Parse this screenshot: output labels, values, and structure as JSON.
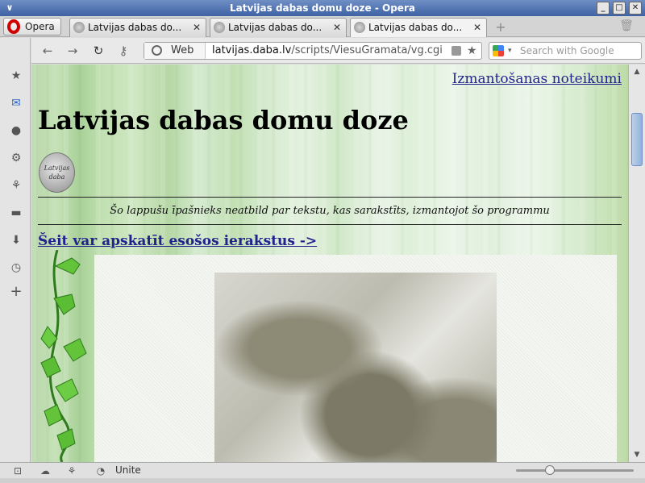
{
  "window": {
    "title": "Latvijas dabas domu doze - Opera",
    "menu_symbol": "∨",
    "btn_minimize": "_",
    "btn_maximize": "□",
    "btn_close": "✕"
  },
  "tabbar": {
    "opera_label": "Opera",
    "tabs": [
      {
        "label": "Latvijas dabas do...",
        "close": "✕"
      },
      {
        "label": "Latvijas dabas do...",
        "close": "✕"
      },
      {
        "label": "Latvijas dabas do...",
        "close": "✕"
      }
    ],
    "new_tab_symbol": "+",
    "trash_symbol": "🗑"
  },
  "toolbar": {
    "back_symbol": "←",
    "forward_symbol": "→",
    "reload_symbol": "↻",
    "key_symbol": "⚷",
    "web_label": "Web",
    "url_host": "latvijas.daba.lv",
    "url_path": "/scripts/ViesuGramata/vg.cgi",
    "bookmark_symbol": "★",
    "search_placeholder": "Search with Google",
    "search_dropdown_symbol": "▾"
  },
  "left_panel": [
    {
      "icon": "bookmarks-icon",
      "symbol": "★"
    },
    {
      "icon": "mail-icon",
      "symbol": "✉"
    },
    {
      "icon": "contacts-icon",
      "symbol": "●"
    },
    {
      "icon": "settings-icon",
      "symbol": "⚙"
    },
    {
      "icon": "unite-icon",
      "symbol": "⚘"
    },
    {
      "icon": "notes-icon",
      "symbol": "▬"
    },
    {
      "icon": "downloads-icon",
      "symbol": "⬇"
    },
    {
      "icon": "history-icon",
      "symbol": "◷"
    },
    {
      "icon": "add-panel-icon",
      "symbol": "+"
    }
  ],
  "page": {
    "terms_link": "Izmantošanas noteikumi",
    "title": "Latvijas dabas domu doze",
    "logo_text": "Latvijas daba",
    "disclaimer": "Šo lappušu īpašnieks neatbild par tekstu, kas sarakstīts, izmantojot šo programmu",
    "entries_link": "Šeit var apskatīt esošos ierakstus ->"
  },
  "scrollbar": {
    "up_symbol": "▲",
    "down_symbol": "▼"
  },
  "statusbar": {
    "panel_toggle_symbol": "⊡",
    "cloud_symbol": "☁",
    "unite_symbol": "⚘",
    "speed_symbol": "◔",
    "unite_label": "Unite"
  },
  "colors": {
    "link": "#23238e",
    "titlebar": "#3e62a4",
    "page_green": "#c2e1b3"
  }
}
